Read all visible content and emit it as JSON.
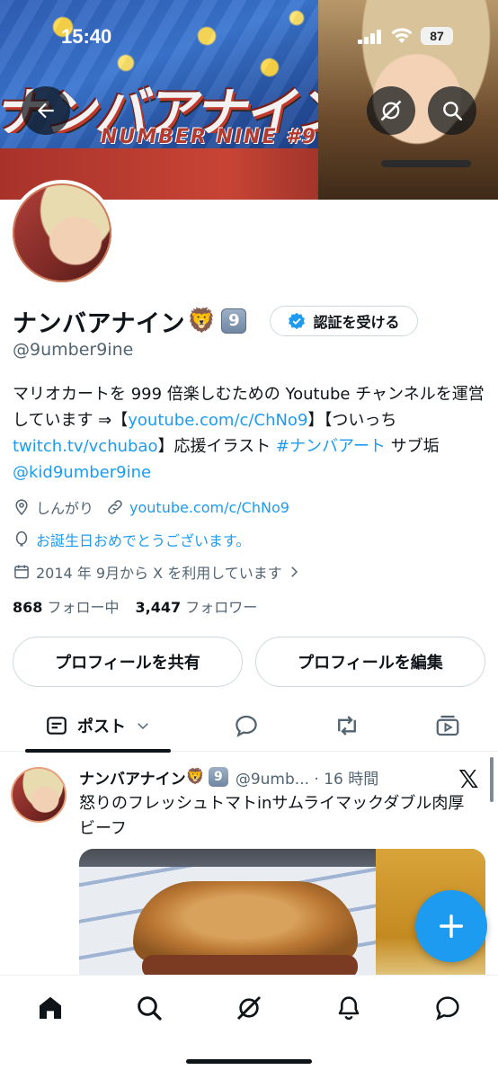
{
  "status_bar": {
    "time": "15:40",
    "battery": "87"
  },
  "banner": {
    "logo_text": "ナンバアナイン",
    "logo_sub": "NUMBER NINE #9"
  },
  "profile": {
    "name": "ナンバアナイン",
    "name_emoji": "🦁",
    "name_badge": "9",
    "verify_label": "認証を受ける",
    "handle": "@9umber9ine",
    "bio": {
      "part1": "マリオカートを 999 倍楽しむための Youtube チャンネルを運営しています ⇒【",
      "link1": "youtube.com/c/ChNo9",
      "part2": "】【ついっち ",
      "link2": "twitch.tv/vchubao",
      "part3": "】応援イラスト ",
      "hashtag": "#ナンバアート",
      "part4": " サブ垢",
      "link3": "@kid9umber9ine"
    },
    "location": "しんがり",
    "website": "youtube.com/c/ChNo9",
    "birthday": "お誕生日おめでとうございます。",
    "joined": "2014 年 9月から X を利用しています",
    "following_count": "868",
    "following_label": "フォロー中",
    "followers_count": "3,447",
    "followers_label": "フォロワー",
    "share_button": "プロフィールを共有",
    "edit_button": "プロフィールを編集"
  },
  "tabs": {
    "active_label": "ポスト"
  },
  "post": {
    "name": "ナンバアナイン",
    "emoji": "🦁",
    "badge": "9",
    "handle_time": "@9umb... · 16 時間",
    "text": "怒りのフレッシュトマトinサムライマックダブル肉厚ビーフ"
  },
  "colors": {
    "accent": "#1d9bf0",
    "text": "#0f1419",
    "secondary": "#536471"
  }
}
